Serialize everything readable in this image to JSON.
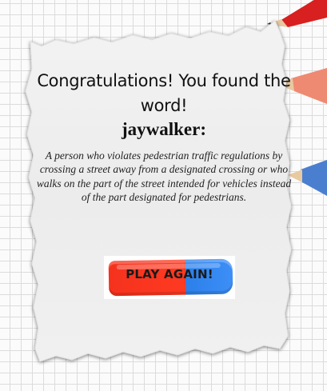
{
  "message": {
    "headline": "Congratulations! You found the word!",
    "word": "jaywalker:",
    "definition": "A person who violates pedestrian traffic regulations by crossing a street away from a designated crossing or who walks on the part of the street intended for vehicles instead of the part designated for pedestrians."
  },
  "actions": {
    "play_again_label": "PLAY AGAIN!"
  },
  "colors": {
    "eraser_red": "#f5321d",
    "eraser_blue": "#3d8ff7",
    "pencil_red": "#e0242a",
    "pencil_salmon": "#f08a72",
    "pencil_blue": "#4a7fd0"
  }
}
